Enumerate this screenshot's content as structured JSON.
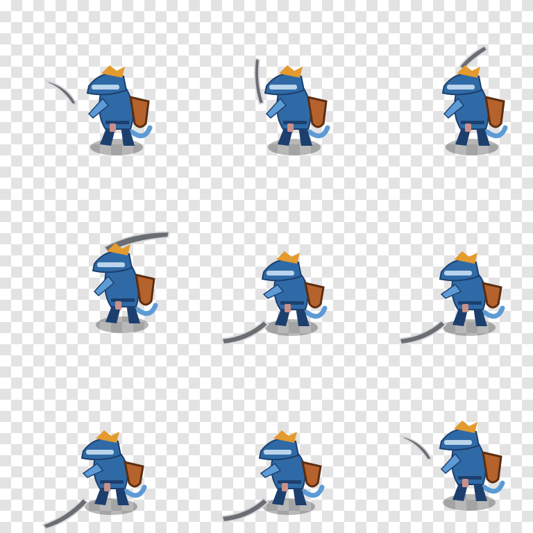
{
  "sprite_sheet": {
    "colors": {
      "body": "#2f6aa6",
      "body_dark": "#1c3f6e",
      "body_light": "#5d9bd6",
      "crest": "#e39a2e",
      "visor": "#b9d4ec",
      "shield_wood": "#b5622d",
      "shield_rim": "#5a2d12",
      "pouch": "#c9908a",
      "blade": "#6a6d72",
      "blade_edge": "#d6d8db",
      "shadow": "#000000"
    },
    "frames": [
      {
        "pose": "idle-forward",
        "weapon": "forward"
      },
      {
        "pose": "raise",
        "weapon": "raised"
      },
      {
        "pose": "overhead",
        "weapon": "overhead"
      },
      {
        "pose": "windup",
        "weapon": "back"
      },
      {
        "pose": "slash-low",
        "weapon": "low"
      },
      {
        "pose": "slash-low-follow",
        "weapon": "low"
      },
      {
        "pose": "crouch-low",
        "weapon": "low-down"
      },
      {
        "pose": "crouch-sweep",
        "weapon": "low"
      },
      {
        "pose": "recover",
        "weapon": "forward"
      }
    ]
  }
}
